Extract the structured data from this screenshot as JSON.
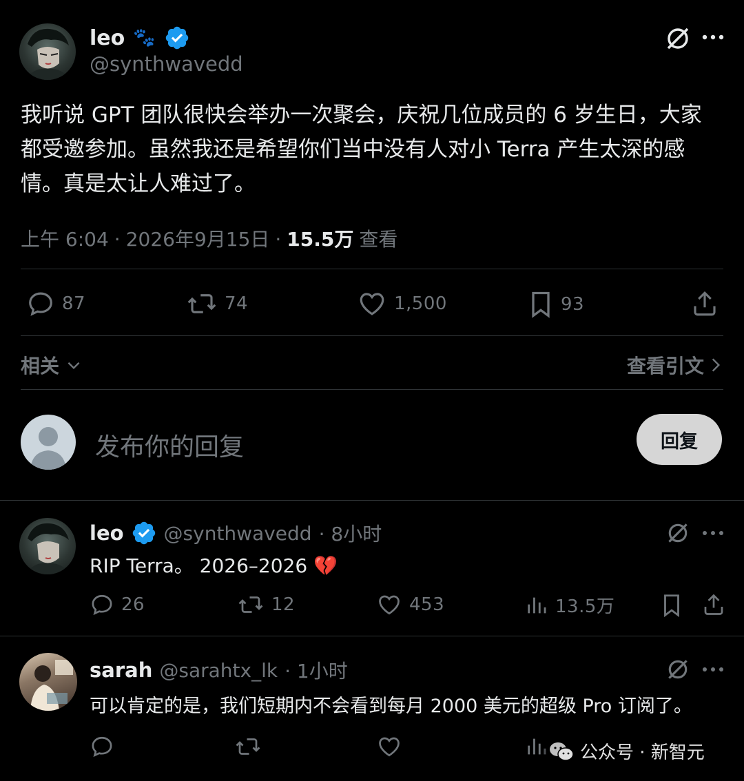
{
  "main_tweet": {
    "author_name": "leo",
    "author_emoji": "🐾",
    "handle": "@synthwavedd",
    "text": "我听说 GPT 团队很快会举办一次聚会，庆祝几位成员的 6 岁生日，大家都受邀参加。虽然我还是希望你们当中没有人对小 Terra 产生太深的感情。真是太让人难过了。",
    "time": "上午 6:04",
    "date": "2026年9月15日",
    "views_count": "15.5万",
    "views_label": "查看",
    "replies": "87",
    "retweets": "74",
    "likes": "1,500",
    "bookmarks": "93"
  },
  "related": {
    "label": "相关",
    "quotes_label": "查看引文"
  },
  "composer": {
    "placeholder": "发布你的回复",
    "reply_button": "回复"
  },
  "replies": [
    {
      "author_name": "leo",
      "handle": "@synthwavedd",
      "time": "· 8小时",
      "text": "RIP Terra。 2026–2026 💔",
      "replies": "26",
      "retweets": "12",
      "likes": "453",
      "views": "13.5万"
    },
    {
      "author_name": "sarah",
      "handle": "@sarahtx_lk",
      "time": "· 1小时",
      "text": "可以肯定的是，我们短期内不会看到每月 2000 美元的超级 Pro 订阅了。",
      "replies": "",
      "retweets": "",
      "likes": "",
      "views": ""
    }
  ],
  "watermark": {
    "text": "公众号 · 新智元"
  },
  "colors": {
    "background": "#000000",
    "text": "#e7e9ea",
    "muted": "#71767b",
    "verified": "#1d9bf0",
    "divider": "#2f3336",
    "reply_button_bg": "#d6d6d6"
  }
}
